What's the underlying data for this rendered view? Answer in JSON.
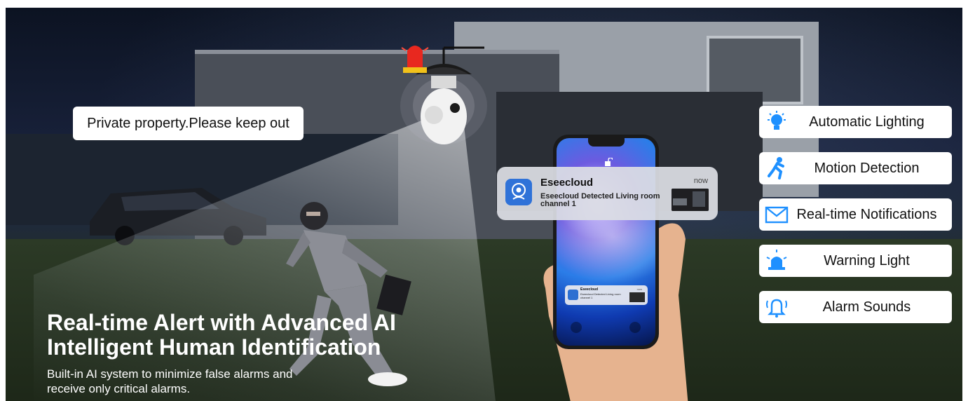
{
  "caption": "",
  "sign": {
    "text": "Private property.Please keep out"
  },
  "notification": {
    "app_name": "Eseecloud",
    "message": "Eseecloud Detected Living room channel 1",
    "time": "now"
  },
  "mini_notification": {
    "app_name": "Eseecloud",
    "message": "Eseecloud Detected Living room channel 1",
    "time": "now"
  },
  "features": [
    {
      "label": "Automatic Lighting",
      "icon": "lightbulb-icon"
    },
    {
      "label": "Motion Detection",
      "icon": "running-person-icon"
    },
    {
      "label": "Real-time Notifications",
      "icon": "envelope-icon"
    },
    {
      "label": "Warning Light",
      "icon": "siren-light-icon"
    },
    {
      "label": "Alarm Sounds",
      "icon": "alarm-bell-icon"
    }
  ],
  "headline": {
    "line1": "Real-time Alert with Advanced AI",
    "line2": "Intelligent Human Identification"
  },
  "subline": {
    "line1": "Built-in AI system to minimize false alarms and",
    "line2": "receive only critical alarms."
  },
  "colors": {
    "accent_blue": "#1e90ff",
    "siren_red": "#e8281f",
    "card_white": "#ffffff"
  }
}
